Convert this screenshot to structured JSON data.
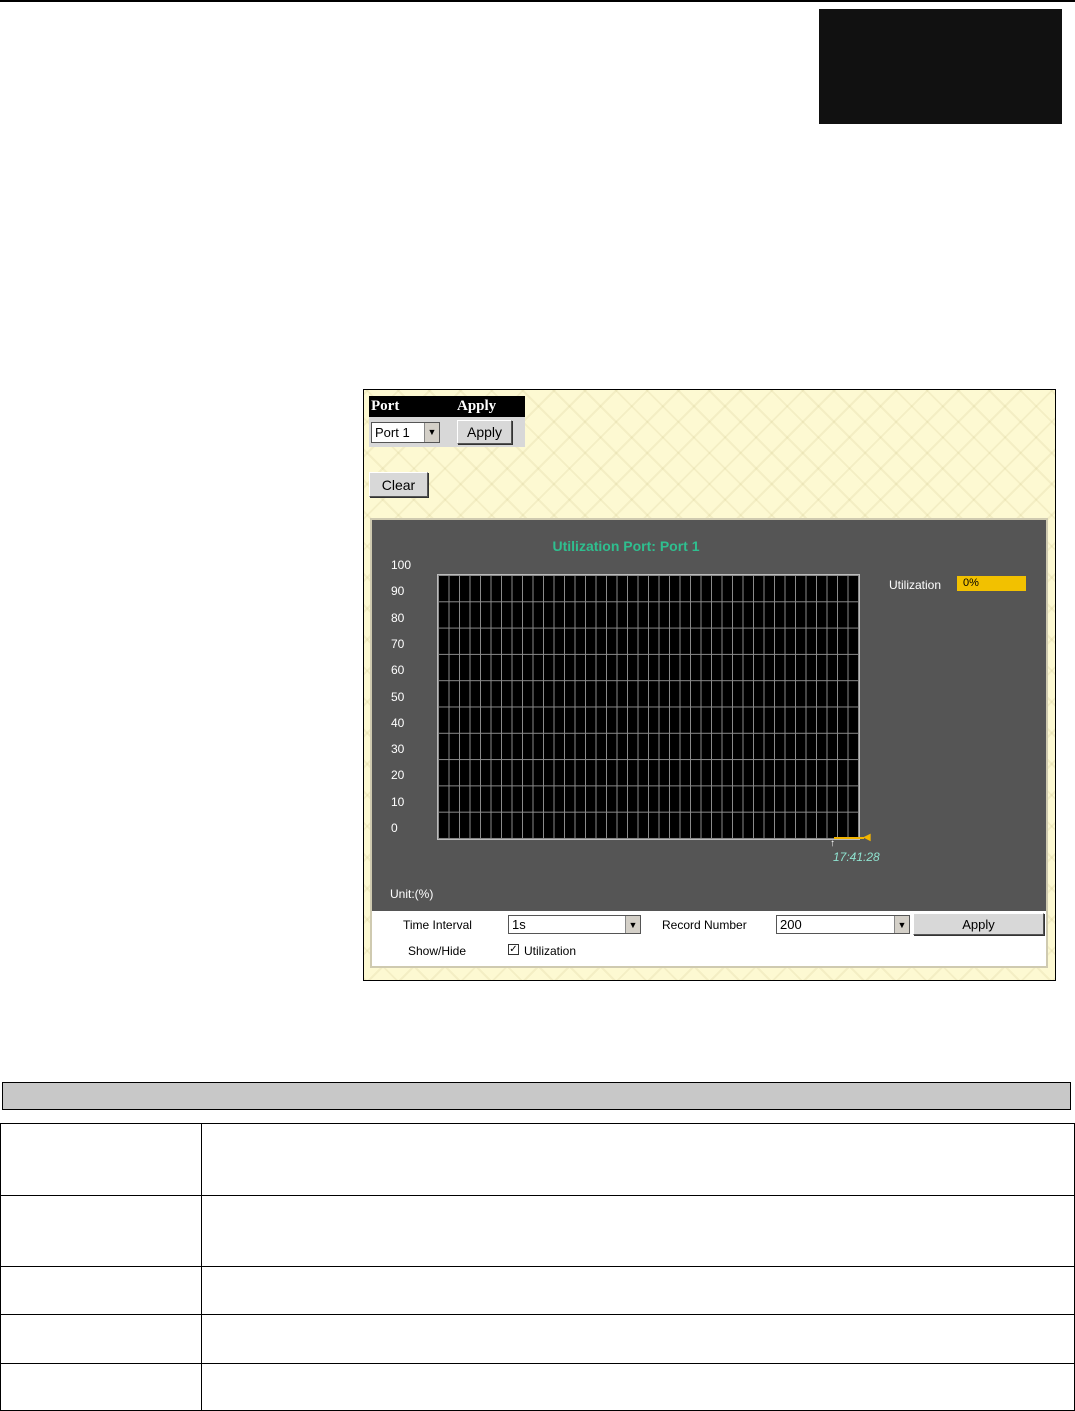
{
  "port_selector": {
    "col_port": "Port",
    "col_apply": "Apply",
    "selected_port": "Port 1",
    "apply_label": "Apply"
  },
  "clear_label": "Clear",
  "graph": {
    "title": "Utilization  Port: Port 1",
    "y_ticks": [
      "100",
      "90",
      "80",
      "70",
      "60",
      "50",
      "40",
      "30",
      "20",
      "10",
      "0"
    ],
    "time_label": "17:41:28",
    "unit": "Unit:(%)",
    "legend_label": "Utilization",
    "legend_value": "0%",
    "accent_color": "#2fbf8f",
    "series_color": "#f2b400"
  },
  "controls": {
    "time_interval_label": "Time Interval",
    "time_interval_value": "1s",
    "record_number_label": "Record Number",
    "record_number_value": "200",
    "apply_label": "Apply",
    "show_hide_label": "Show/Hide",
    "utilization_checkbox_label": "Utilization"
  },
  "chart_data": {
    "type": "line",
    "ylim": [
      0,
      100
    ],
    "series": [
      {
        "name": "Utilization",
        "points": [
          {
            "x": "17:41:28",
            "y": 0
          }
        ]
      }
    ],
    "grid": true,
    "legend": "right"
  }
}
